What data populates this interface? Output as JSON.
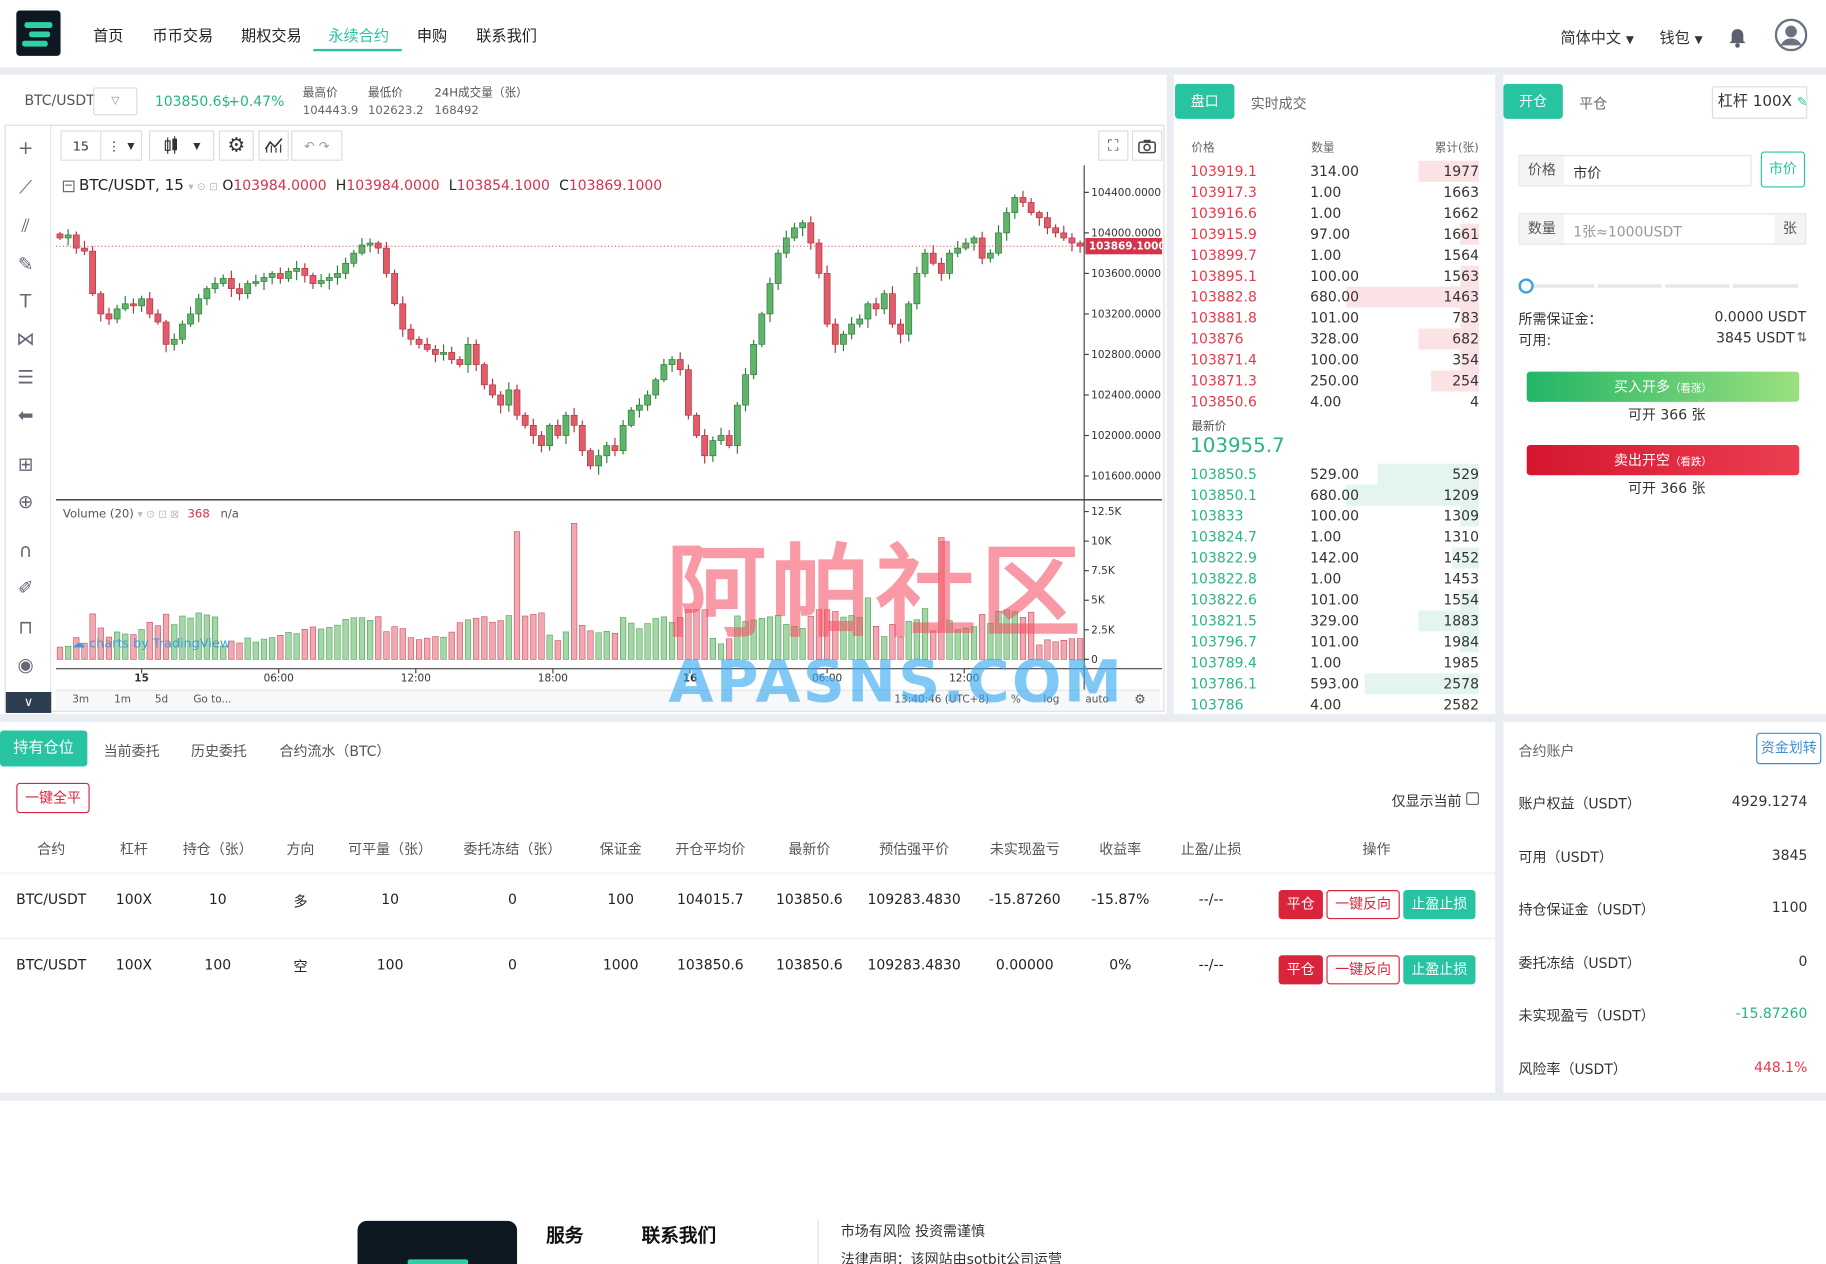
{
  "nav": {
    "items": [
      "首页",
      "币币交易",
      "期权交易",
      "永续合约",
      "申购",
      "联系我们"
    ],
    "active_index": 3,
    "language": "简体中文",
    "wallet": "钱包"
  },
  "ticker": {
    "pair": "BTC/USDT",
    "price": "103850.6$",
    "change": "+0.47%",
    "high_label": "最高价",
    "high": "104443.9",
    "low_label": "最低价",
    "low": "102623.2",
    "vol_label": "24H成交量（张）",
    "vol": "168492"
  },
  "chart_toolbar": {
    "interval": "15"
  },
  "chart_legend": {
    "symbol": "BTC/USDT, 15",
    "o_label": "O",
    "o": "103984.0000",
    "h_label": "H",
    "h": "103984.0000",
    "l_label": "L",
    "l": "103854.1000",
    "c_label": "C",
    "c": "103869.1000",
    "volume_label": "Volume (20)",
    "volume_value": "368",
    "volume_na": "n/a",
    "watermark": "charts by TradingView"
  },
  "chart_footer": {
    "ranges": [
      "3m",
      "1m",
      "5d"
    ],
    "goto": "Go to...",
    "time": "13:40:46 (UTC+8)",
    "pct": "%",
    "log": "log",
    "auto": "auto"
  },
  "chart_data": {
    "type": "candlestick",
    "price_ticks": [
      "104400.0000",
      "104000.0000",
      "103600.0000",
      "103200.0000",
      "102800.0000",
      "102400.0000",
      "102000.0000",
      "101600.0000"
    ],
    "price_tick_values": [
      104400,
      104000,
      103600,
      103200,
      102800,
      102400,
      102000,
      101600
    ],
    "ylim": [
      101400,
      104620
    ],
    "current_price_label": "103869.1000",
    "current_price": 103869.1,
    "volume_ticks": [
      "12.5K",
      "10K",
      "7.5K",
      "5K",
      "2.5K",
      "0"
    ],
    "volume_tick_values": [
      12500,
      10000,
      7500,
      5000,
      2500,
      0
    ],
    "volume_ylim": [
      0,
      13200
    ],
    "time_ticks": [
      "15",
      "06:00",
      "12:00",
      "18:00",
      "16",
      "06:00",
      "12:00"
    ],
    "time_tick_positions": [
      10,
      26,
      42,
      58,
      74,
      90,
      106
    ],
    "closes": [
      103950,
      103980,
      103850,
      103820,
      103400,
      103200,
      103150,
      103250,
      103300,
      103280,
      103350,
      103200,
      103120,
      102900,
      102950,
      103100,
      103200,
      103350,
      103450,
      103500,
      103550,
      103450,
      103400,
      103500,
      103520,
      103560,
      103600,
      103550,
      103620,
      103650,
      103580,
      103500,
      103530,
      103560,
      103600,
      103700,
      103800,
      103880,
      103900,
      103850,
      103600,
      103300,
      103050,
      102950,
      102900,
      102850,
      102800,
      102820,
      102750,
      102700,
      102900,
      102700,
      102500,
      102400,
      102300,
      102450,
      102200,
      102100,
      102000,
      101900,
      102100,
      102000,
      102200,
      102100,
      101850,
      101700,
      101800,
      101900,
      101850,
      102100,
      102250,
      102300,
      102400,
      102550,
      102700,
      102750,
      102650,
      102200,
      102000,
      101800,
      101950,
      102000,
      101900,
      102300,
      102600,
      102900,
      103200,
      103500,
      103800,
      103950,
      104050,
      104100,
      103900,
      103600,
      103100,
      102900,
      103000,
      103100,
      103150,
      103300,
      103250,
      103400,
      103100,
      103000,
      103300,
      103600,
      103800,
      103700,
      103600,
      103800,
      103850,
      103900,
      103950,
      103750,
      103800,
      104000,
      104200,
      104350,
      104300,
      104200,
      104150,
      104050,
      104000,
      103950,
      103900,
      103869
    ]
  },
  "orderbook": {
    "tab_active": "盘口",
    "tab_other": "实时成交",
    "col_price": "价格",
    "col_qty": "数量",
    "col_total": "累计(张)",
    "asks": [
      {
        "price": "103919.1",
        "qty": "314.00",
        "total": "1977",
        "depth": 0.46
      },
      {
        "price": "103917.3",
        "qty": "1.00",
        "total": "1663",
        "depth": 0
      },
      {
        "price": "103916.6",
        "qty": "1.00",
        "total": "1662",
        "depth": 0
      },
      {
        "price": "103915.9",
        "qty": "97.00",
        "total": "1661",
        "depth": 0.14
      },
      {
        "price": "103899.7",
        "qty": "1.00",
        "total": "1564",
        "depth": 0
      },
      {
        "price": "103895.1",
        "qty": "100.00",
        "total": "1563",
        "depth": 0.14
      },
      {
        "price": "103882.8",
        "qty": "680.00",
        "total": "1463",
        "depth": 1.0
      },
      {
        "price": "103881.8",
        "qty": "101.00",
        "total": "783",
        "depth": 0.14
      },
      {
        "price": "103876",
        "qty": "328.00",
        "total": "682",
        "depth": 0.46
      },
      {
        "price": "103871.4",
        "qty": "100.00",
        "total": "354",
        "depth": 0.14
      },
      {
        "price": "103871.3",
        "qty": "250.00",
        "total": "254",
        "depth": 0.36
      },
      {
        "price": "103850.6",
        "qty": "4.00",
        "total": "4",
        "depth": 0
      }
    ],
    "last_label": "最新价",
    "last_price": "103955.7",
    "bids": [
      {
        "price": "103850.5",
        "qty": "529.00",
        "total": "529",
        "depth": 0.76
      },
      {
        "price": "103850.1",
        "qty": "680.00",
        "total": "1209",
        "depth": 1.0
      },
      {
        "price": "103833",
        "qty": "100.00",
        "total": "1309",
        "depth": 0.14
      },
      {
        "price": "103824.7",
        "qty": "1.00",
        "total": "1310",
        "depth": 0
      },
      {
        "price": "103822.9",
        "qty": "142.00",
        "total": "1452",
        "depth": 0.2
      },
      {
        "price": "103822.8",
        "qty": "1.00",
        "total": "1453",
        "depth": 0
      },
      {
        "price": "103822.6",
        "qty": "101.00",
        "total": "1554",
        "depth": 0.14
      },
      {
        "price": "103821.5",
        "qty": "329.00",
        "total": "1883",
        "depth": 0.46
      },
      {
        "price": "103796.7",
        "qty": "101.00",
        "total": "1984",
        "depth": 0.14
      },
      {
        "price": "103789.4",
        "qty": "1.00",
        "total": "1985",
        "depth": 0
      },
      {
        "price": "103786.1",
        "qty": "593.00",
        "total": "2578",
        "depth": 0.86
      },
      {
        "price": "103786",
        "qty": "4.00",
        "total": "2582",
        "depth": 0
      }
    ]
  },
  "trade": {
    "tab_open": "开仓",
    "tab_close": "平仓",
    "leverage": "杠杆 100X",
    "price_label": "价格",
    "price_value": "市价",
    "market_btn": "市价",
    "qty_label": "数量",
    "qty_placeholder": "1张≈1000USDT",
    "qty_unit": "张",
    "slider_value": 0,
    "margin_label": "所需保证金：",
    "margin_value": "0.0000 USDT",
    "avail_label": "可用:",
    "avail_value": "3845 USDT",
    "buy_label": "买入开多",
    "buy_sub": "（看涨）",
    "buy_can": "可开 366 张",
    "sell_label": "卖出开空",
    "sell_sub": "（看跌）",
    "sell_can": "可开 366 张"
  },
  "positions": {
    "tabs": [
      "持有仓位",
      "当前委托",
      "历史委托",
      "合约流水（BTC）"
    ],
    "close_all": "一键全平",
    "only_current": "仅显示当前",
    "headers": [
      "合约",
      "杠杆",
      "持仓（张）",
      "方向",
      "可平量（张）",
      "委托冻结（张）",
      "保证金",
      "开仓平均价",
      "最新价",
      "预估强平价",
      "未实现盈亏",
      "收益率",
      "止盈/止损",
      "操作"
    ],
    "rows": [
      [
        "BTC/USDT",
        "100X",
        "10",
        "多",
        "10",
        "0",
        "100",
        "104015.7",
        "103850.6",
        "109283.4830",
        "-15.87260",
        "-15.87%",
        "--/--"
      ],
      [
        "BTC/USDT",
        "100X",
        "100",
        "空",
        "100",
        "0",
        "1000",
        "103850.6",
        "103850.6",
        "109283.4830",
        "0.00000",
        "0%",
        "--/--"
      ]
    ],
    "action_close": "平仓",
    "action_reverse": "一键反向",
    "action_tpsl": "止盈止损"
  },
  "account": {
    "title": "合约账户",
    "transfer": "资金划转",
    "items": [
      {
        "label": "账户权益（USDT）",
        "value": "4929.1274",
        "color": "#333333"
      },
      {
        "label": "可用（USDT）",
        "value": "3845",
        "color": "#333333"
      },
      {
        "label": "持仓保证金（USDT）",
        "value": "1100",
        "color": "#333333"
      },
      {
        "label": "委托冻结（USDT）",
        "value": "0",
        "color": "#333333"
      },
      {
        "label": "未实现盈亏（USDT）",
        "value": "-15.87260",
        "color": "#28b487"
      },
      {
        "label": "风险率（USDT）",
        "value": "448.1%",
        "color": "#e8374a"
      }
    ]
  },
  "footer": {
    "services": "服务",
    "contact": "联系我们",
    "risk": "市场有风险 投资需谨慎",
    "legal": "法律声明：该网站由sotbit公司运营"
  },
  "watermark": {
    "cn": "阿帕社区",
    "en": "APASNS.COM"
  },
  "colors": {
    "accent": "#28c4a2",
    "up": "#e8374a",
    "down": "#28b487",
    "sell_button": "#d9243b"
  }
}
